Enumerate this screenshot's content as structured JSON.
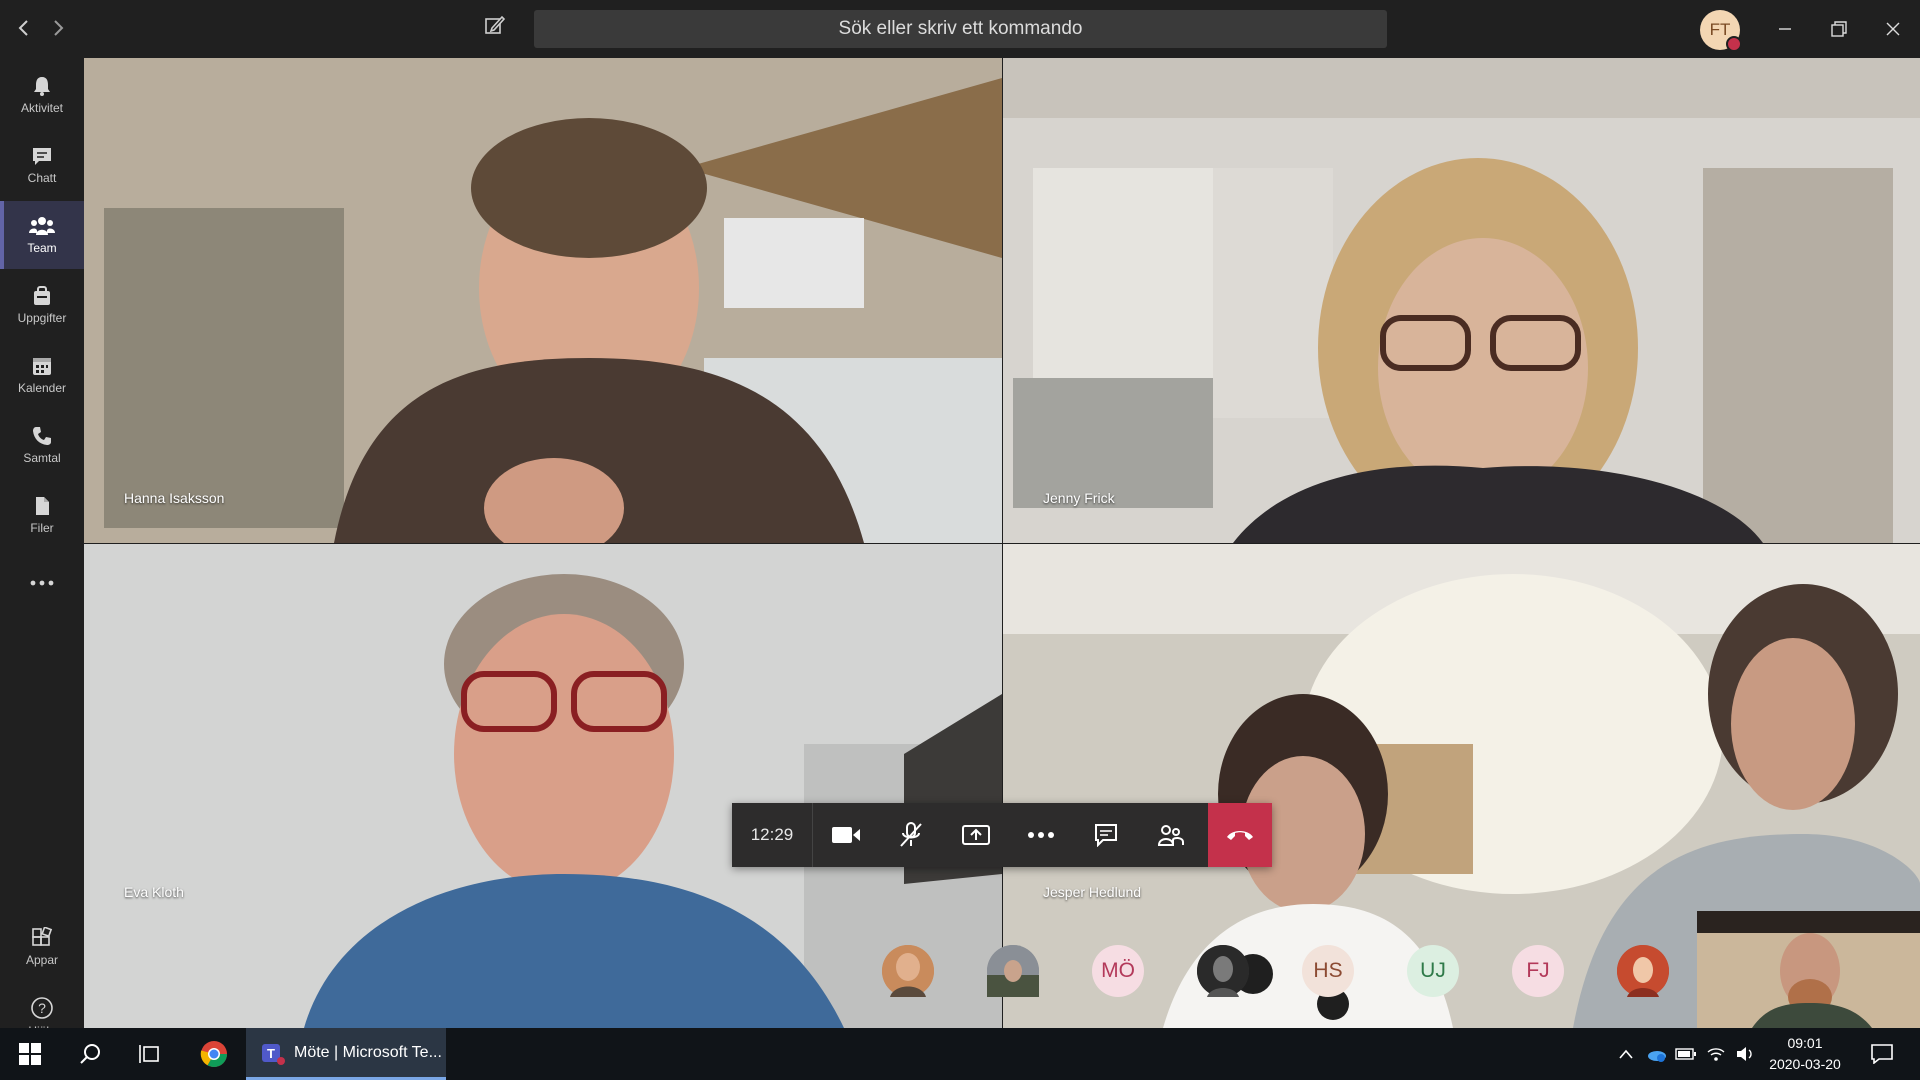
{
  "search": {
    "placeholder": "Sök eller skriv ett kommando"
  },
  "user": {
    "initials": "FT",
    "status_color": "#c4314b"
  },
  "rail": [
    {
      "label": "Aktivitet",
      "icon": "bell-icon"
    },
    {
      "label": "Chatt",
      "icon": "chat-icon"
    },
    {
      "label": "Team",
      "icon": "teams-icon",
      "active": true
    },
    {
      "label": "Uppgifter",
      "icon": "assignments-icon"
    },
    {
      "label": "Kalender",
      "icon": "calendar-icon"
    },
    {
      "label": "Samtal",
      "icon": "phone-icon"
    },
    {
      "label": "Filer",
      "icon": "files-icon"
    },
    {
      "label": "Appar",
      "icon": "apps-icon"
    },
    {
      "label": "Hjälp",
      "icon": "help-icon"
    }
  ],
  "video": {
    "tiles": [
      {
        "name": "Hanna Isaksson"
      },
      {
        "name": "Jenny Frick"
      },
      {
        "name": "Eva Kloth"
      },
      {
        "name": "Jesper Hedlund"
      }
    ]
  },
  "callbar": {
    "timer": "12:29"
  },
  "participants": [
    {
      "initials": "",
      "kind": "photo",
      "color": "#c98b5c"
    },
    {
      "initials": "",
      "kind": "photo",
      "color": "#8a8f96"
    },
    {
      "initials": "MÖ",
      "kind": "initials",
      "bg": "#f6dde3",
      "fg": "#b3395a"
    },
    {
      "initials": "",
      "kind": "photo",
      "color": "#3a3a3a"
    },
    {
      "initials": "HS",
      "kind": "initials",
      "bg": "#f2e2da",
      "fg": "#8c4b33"
    },
    {
      "initials": "UJ",
      "kind": "initials",
      "bg": "#dcefe1",
      "fg": "#2f7a49"
    },
    {
      "initials": "FJ",
      "kind": "initials",
      "bg": "#f6dde3",
      "fg": "#b3395a"
    },
    {
      "initials": "",
      "kind": "photo",
      "color": "#b8452e"
    }
  ],
  "taskbar": {
    "app_label": "Möte | Microsoft Te...",
    "time": "09:01",
    "date": "2020-03-20"
  }
}
